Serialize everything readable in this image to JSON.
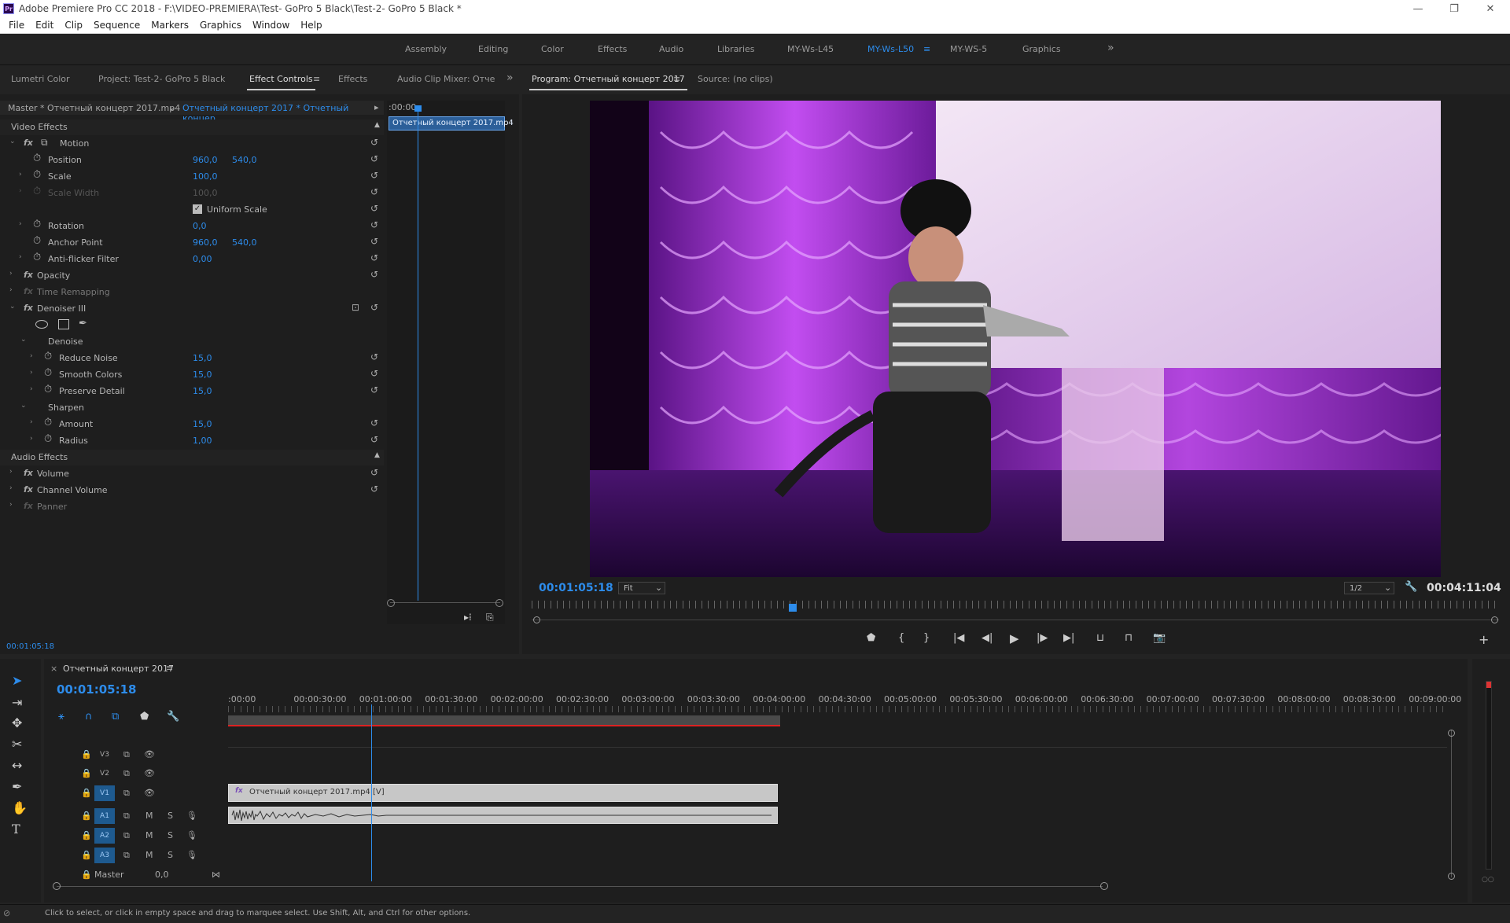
{
  "window": {
    "title": "Adobe Premiere Pro CC 2018 - F:\\VIDEO-PREMIERA\\Test- GoPro 5 Black\\Test-2- GoPro 5 Black *",
    "app_badge": "Pr",
    "min_icon": "minimize-icon",
    "max_icon": "maximize-icon",
    "close_icon": "close-icon"
  },
  "menu": [
    "File",
    "Edit",
    "Clip",
    "Sequence",
    "Markers",
    "Graphics",
    "Window",
    "Help"
  ],
  "workspaces": [
    {
      "label": "Assembly",
      "active": false
    },
    {
      "label": "Editing",
      "active": false
    },
    {
      "label": "Color",
      "active": false
    },
    {
      "label": "Effects",
      "active": false
    },
    {
      "label": "Audio",
      "active": false
    },
    {
      "label": "Libraries",
      "active": false
    },
    {
      "label": "MY-Ws-L45",
      "active": false
    },
    {
      "label": "MY-Ws-L50",
      "active": true
    },
    {
      "label": "MY-WS-5",
      "active": false
    },
    {
      "label": "Graphics",
      "active": false
    }
  ],
  "left_tabs": [
    "Lumetri Color",
    "Project: Test-2- GoPro 5 Black",
    "Effect Controls",
    "Effects",
    "Audio Clip Mixer: Отче"
  ],
  "effect_controls": {
    "source": "Master * Отчетный концерт 2017.mp4",
    "sequence": "Отчетный концерт 2017 * Отчетный концер...",
    "mini_time": ":00:00",
    "clip_label": "Отчетный концерт 2017.mp4",
    "video_effects": "Video Effects",
    "audio_effects": "Audio Effects",
    "motion": "Motion",
    "position": {
      "label": "Position",
      "x": "960,0",
      "y": "540,0"
    },
    "scale": {
      "label": "Scale",
      "v": "100,0"
    },
    "scale_width": {
      "label": "Scale Width",
      "v": "100,0"
    },
    "uniform_scale": "Uniform Scale",
    "rotation": {
      "label": "Rotation",
      "v": "0,0"
    },
    "anchor": {
      "label": "Anchor Point",
      "x": "960,0",
      "y": "540,0"
    },
    "antiflicker": {
      "label": "Anti-flicker Filter",
      "v": "0,00"
    },
    "opacity": "Opacity",
    "time_remap": "Time Remapping",
    "denoiser": "Denoiser III",
    "denoise": "Denoise",
    "reduce_noise": {
      "label": "Reduce Noise",
      "v": "15,0"
    },
    "smooth_colors": {
      "label": "Smooth Colors",
      "v": "15,0"
    },
    "preserve_detail": {
      "label": "Preserve Detail",
      "v": "15,0"
    },
    "sharpen": "Sharpen",
    "amount": {
      "label": "Amount",
      "v": "15,0"
    },
    "radius": {
      "label": "Radius",
      "v": "1,00"
    },
    "volume": "Volume",
    "channel_volume": "Channel Volume",
    "panner": "Panner",
    "timecode": "00:01:05:18"
  },
  "program": {
    "tab": "Program: Отчетный концерт 2017",
    "source_tab": "Source: (no clips)",
    "timecode": "00:01:05:18",
    "fit": "Fit",
    "resolution": "1/2",
    "duration": "00:04:11:04",
    "playhead_fraction": 0.27
  },
  "timeline": {
    "title": "Отчетный концерт 2017",
    "timecode": "00:01:05:18",
    "ruler": [
      ":00:00",
      "00:00:30:00",
      "00:01:00:00",
      "00:01:30:00",
      "00:02:00:00",
      "00:02:30:00",
      "00:03:00:00",
      "00:03:30:00",
      "00:04:00:00",
      "00:04:30:00",
      "00:05:00:00",
      "00:05:30:00",
      "00:06:00:00",
      "00:06:30:00",
      "00:07:00:00",
      "00:07:30:00",
      "00:08:00:00",
      "00:08:30:00",
      "00:09:00:00"
    ],
    "tracks": [
      {
        "name": "V3",
        "type": "video"
      },
      {
        "name": "V2",
        "type": "video"
      },
      {
        "name": "V1",
        "type": "video"
      },
      {
        "name": "A1",
        "type": "audio"
      },
      {
        "name": "A2",
        "type": "audio"
      },
      {
        "name": "A3",
        "type": "audio"
      }
    ],
    "video_clip": "Отчетный концерт 2017.mp4 [V]",
    "master_label": "Master",
    "master_value": "0,0",
    "m": "M",
    "s": "S"
  },
  "status": "Click to select, or click in empty space and drag to marquee select. Use Shift, Alt, and Ctrl for other options."
}
